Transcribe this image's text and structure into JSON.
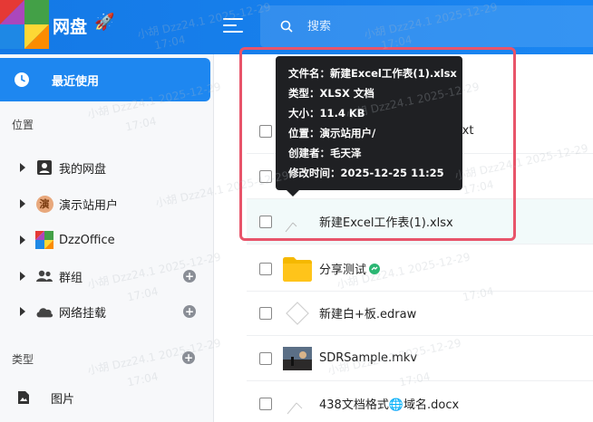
{
  "header": {
    "title": "网盘",
    "rocket": "🚀",
    "search_placeholder": "搜索"
  },
  "sidebar": {
    "recent_label": "最近使用",
    "location_label": "位置",
    "type_label": "类型",
    "items": [
      {
        "label": "我的网盘",
        "icon": "person-icon"
      },
      {
        "label": "演示站用户",
        "icon": "avatar-icon",
        "avatar_char": "演"
      },
      {
        "label": "DzzOffice",
        "icon": "dzz-logo-icon"
      },
      {
        "label": "群组",
        "icon": "group-icon"
      },
      {
        "label": "网络挂载",
        "icon": "cloud-icon"
      }
    ],
    "type_items": [
      {
        "label": "图片",
        "icon": "image-icon"
      }
    ]
  },
  "files": [
    {
      "name": "(1).txt",
      "type": "txt"
    },
    {
      "name": "",
      "type": "file"
    },
    {
      "name": "新建Excel工作表(1).xlsx",
      "type": "xlsx"
    },
    {
      "name": "分享测试",
      "type": "folder",
      "shared": true
    },
    {
      "name": "新建白+板.edraw",
      "type": "edraw"
    },
    {
      "name": "SDRSample.mkv",
      "type": "video"
    },
    {
      "name": "438文档格式🌐域名.docx",
      "type": "docx"
    }
  ],
  "tooltip": {
    "filename": "文件名：新建Excel工作表(1).xlsx",
    "type": "类型：XLSX 文档",
    "size": "大小：11.4 KB",
    "location": "位置：演示站用户/",
    "creator": "创建者：毛天泽",
    "modified": "修改时间：2025-12-25 11:25"
  },
  "watermark": {
    "line1": "小胡 Dzz24.1 2025-12-29",
    "line2": "17:04"
  },
  "colors": {
    "accent": "#1e87f0",
    "highlight": "#e8546a",
    "tooltip_bg": "#1f2023"
  }
}
